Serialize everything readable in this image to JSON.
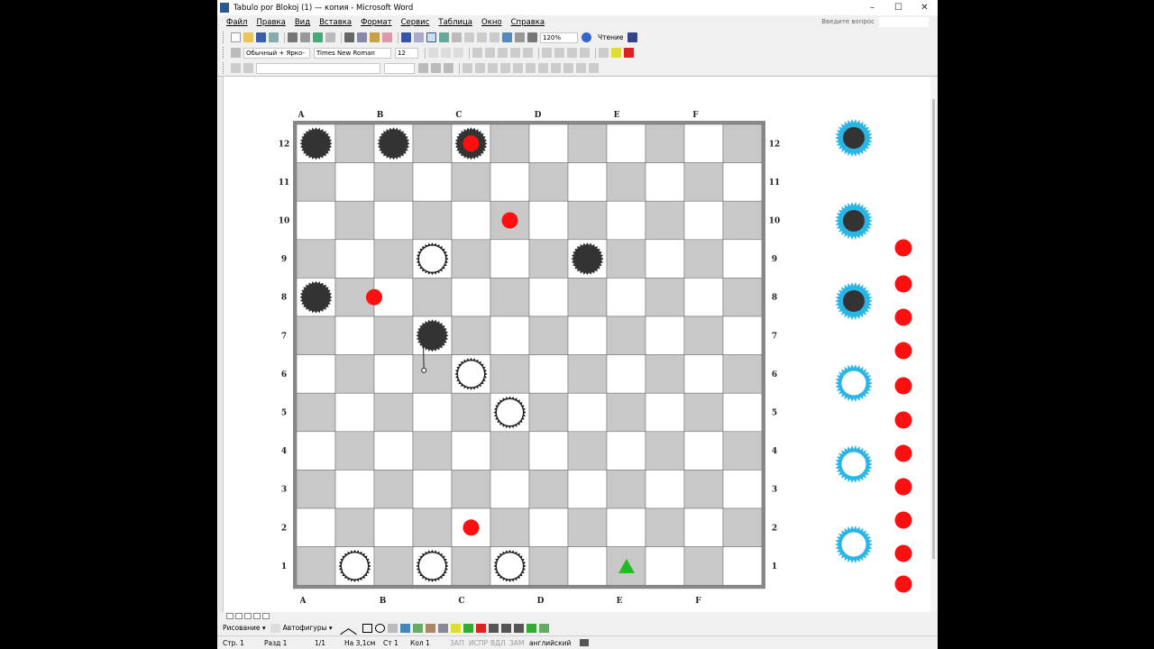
{
  "window": {
    "title": "Tabulo por Blokoj (1) — копия - Microsoft Word",
    "controls": [
      "–",
      "☐",
      "✕"
    ]
  },
  "menu": {
    "items": [
      "Файл",
      "Правка",
      "Вид",
      "Вставка",
      "Формат",
      "Сервис",
      "Таблица",
      "Окно",
      "Справка"
    ],
    "ask_placeholder": "Введите вопрос"
  },
  "toolbar_standard": {
    "zoom": "120%",
    "reading_label": "Чтение"
  },
  "toolbar_format": {
    "style": "Обычный + Ярко-",
    "font": "Times New Roman",
    "size": "12"
  },
  "board": {
    "columns_top": [
      "A",
      "B",
      "C",
      "D",
      "E",
      "F"
    ],
    "columns_bottom": [
      "A",
      "B",
      "C",
      "D",
      "E",
      "F"
    ],
    "rows": [
      "12",
      "11",
      "10",
      "9",
      "8",
      "7",
      "6",
      "5",
      "4",
      "3",
      "2",
      "1"
    ],
    "grid_size": 12,
    "black_pieces": [
      [
        1,
        12
      ],
      [
        3,
        12
      ],
      [
        5,
        12
      ],
      [
        8,
        9
      ],
      [
        1,
        8
      ],
      [
        4,
        7
      ]
    ],
    "white_pieces": [
      [
        4,
        9
      ],
      [
        5,
        6
      ],
      [
        6,
        5
      ],
      [
        2,
        1
      ],
      [
        4,
        1
      ],
      [
        6,
        1
      ]
    ],
    "red_dots": [
      [
        4.5,
        11.5
      ],
      [
        5.5,
        9.5
      ],
      [
        2,
        7.5
      ],
      [
        4.5,
        1.5
      ]
    ],
    "green_triangle": [
      8.5,
      1
    ],
    "arrow": {
      "from": [
        4,
        7
      ],
      "to": [
        3.4,
        6
      ]
    }
  },
  "reserve": {
    "blue_dark": 3,
    "blue_white": 3,
    "red_count": 11
  },
  "drawbar": {
    "drawing": "Рисование ▾",
    "autoshapes": "Автофигуры ▾"
  },
  "status": {
    "page": "Стр. 1",
    "section": "Разд 1",
    "pages": "1/1",
    "at": "На 3,1см",
    "line": "Ст 1",
    "col": "Кол 1",
    "rec": "ЗАП",
    "trk": "ИСПР",
    "ext": "ВДЛ",
    "ovr": "ЗАМ",
    "lang": "английский"
  },
  "colors": {
    "gray_square": "#c8c8c8",
    "black_piece": "#333333",
    "red_dot": "#ff1010",
    "cyan": "#29b6e6",
    "green": "#22bb22"
  }
}
